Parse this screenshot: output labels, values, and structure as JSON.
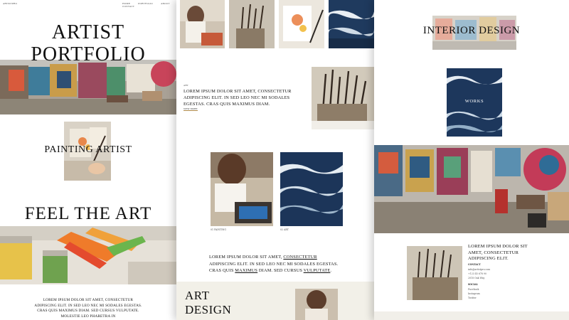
{
  "panel1": {
    "logo": "ARTISTPRO",
    "nav": [
      "HOME",
      "PORTFOLIO",
      "ABOUT",
      "CONTACT"
    ],
    "hero_title_line1": "ARTIST",
    "hero_title_line2": "PORTFOLIO",
    "subtitle": "PAINTING ARTIST",
    "banner": "FEEL THE ART",
    "footer_text": "LOREM IPSUM DOLOR SIT AMET, CONSECTETUR ADIPISCING ELIT. IN SED LEO NEC MI SODALES EGESTAS. CRAS QUIS MAXIMUS DIAM. SED CURSUS VULPUTATE. MOLESTIE LEO PHARETRA IN"
  },
  "panel2": {
    "small_label": "ART",
    "intro_text": "LOREM IPSUM DOLOR SIT AMET, CONSECTETUR ADIPISCING ELIT. IN SED LEO NEC MI SODALES EGESTAS. CRAS QUIS MAXIMUS DIAM.",
    "view_more": "VIEW MORE",
    "caption_left": "01 PAINTING",
    "caption_right": "02 ART",
    "body_text_1": "LOREM IPSUM DOLOR SIT AMET, ",
    "body_link_1": "CONSECTETUR",
    "body_text_2": " ADIPISCING ELIT. IN SED LEO NEC MI SODALES EGESTAS. CRAS QUIS ",
    "body_link_2": "MAXIMUS",
    "body_text_3": " DIAM. SED CURSUS ",
    "body_link_3": "VULPUTATE",
    "body_text_4": ".",
    "section_title_line1": "ART",
    "section_title_line2": "DESIGN"
  },
  "panel3": {
    "title": "INTERIOR DESIGN",
    "works_label": "WORKS",
    "contact_text": "LOREM IPSUM DOLOR SIT AMET, CONSECTETUR ADIPISCING ELIT.",
    "contact_heading": "CONTACT",
    "contact_lines": [
      "info@artistpro.com",
      "+123 45 678 90",
      "2018 Oak Way"
    ],
    "social_heading": "SOCIAL",
    "social_lines": [
      "Facebook",
      "Instagram",
      "Twitter"
    ]
  }
}
